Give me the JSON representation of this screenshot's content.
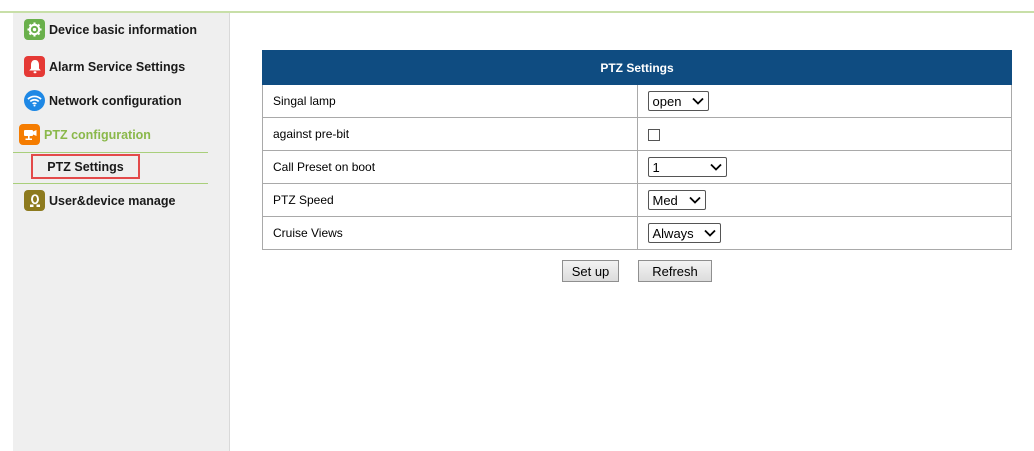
{
  "sidebar": {
    "items": [
      {
        "label": "Device basic information",
        "icon": "gear-icon",
        "color": "#6ab04c"
      },
      {
        "label": "Alarm Service Settings",
        "icon": "bell-icon",
        "color": "#e53935"
      },
      {
        "label": "Network configuration",
        "icon": "wifi-icon",
        "color": "#1e88e5"
      },
      {
        "label": "PTZ configuration",
        "icon": "camera-icon",
        "color": "#f57c00"
      },
      {
        "label": "User&device manage",
        "icon": "user-icon",
        "color": "#8d7a1e"
      }
    ],
    "submenu": {
      "label": "PTZ Settings"
    },
    "active_color": "#8ab84a"
  },
  "ptz": {
    "title": "PTZ Settings",
    "header_color": "#0f4c81",
    "rows": [
      {
        "label": "Singal lamp",
        "type": "select",
        "value": "open"
      },
      {
        "label": "against pre-bit",
        "type": "checkbox",
        "checked": false
      },
      {
        "label": "Call Preset on boot",
        "type": "select",
        "value": "1"
      },
      {
        "label": "PTZ Speed",
        "type": "select",
        "value": "Med"
      },
      {
        "label": "Cruise Views",
        "type": "select",
        "value": "Always"
      }
    ]
  },
  "buttons": {
    "setup": "Set up",
    "refresh": "Refresh"
  }
}
